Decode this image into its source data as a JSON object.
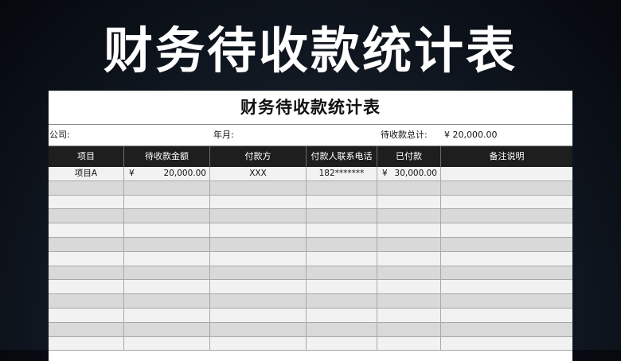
{
  "banner": {
    "title": "财务待收款统计表"
  },
  "sheet": {
    "title": "财务待收款统计表",
    "meta": {
      "company_label": "公司:",
      "month_label": "年月:",
      "total_label": "待收款总计:",
      "total_value": "¥ 20,000.00"
    },
    "columns": [
      "项目",
      "待收款金额",
      "付款方",
      "付款人联系电话",
      "已付款",
      "备注说明"
    ],
    "rows": [
      {
        "item": "项目A",
        "amount_currency": "¥",
        "amount": "20,000.00",
        "payer": "XXX",
        "phone": "182*******",
        "paid_currency": "¥",
        "paid": "30,000.00",
        "note": ""
      }
    ],
    "empty_row_count": 12
  },
  "colors": {
    "header_bg": "#1e1e1e",
    "row_light": "#f2f2f2",
    "row_dark": "#d9d9d9"
  }
}
